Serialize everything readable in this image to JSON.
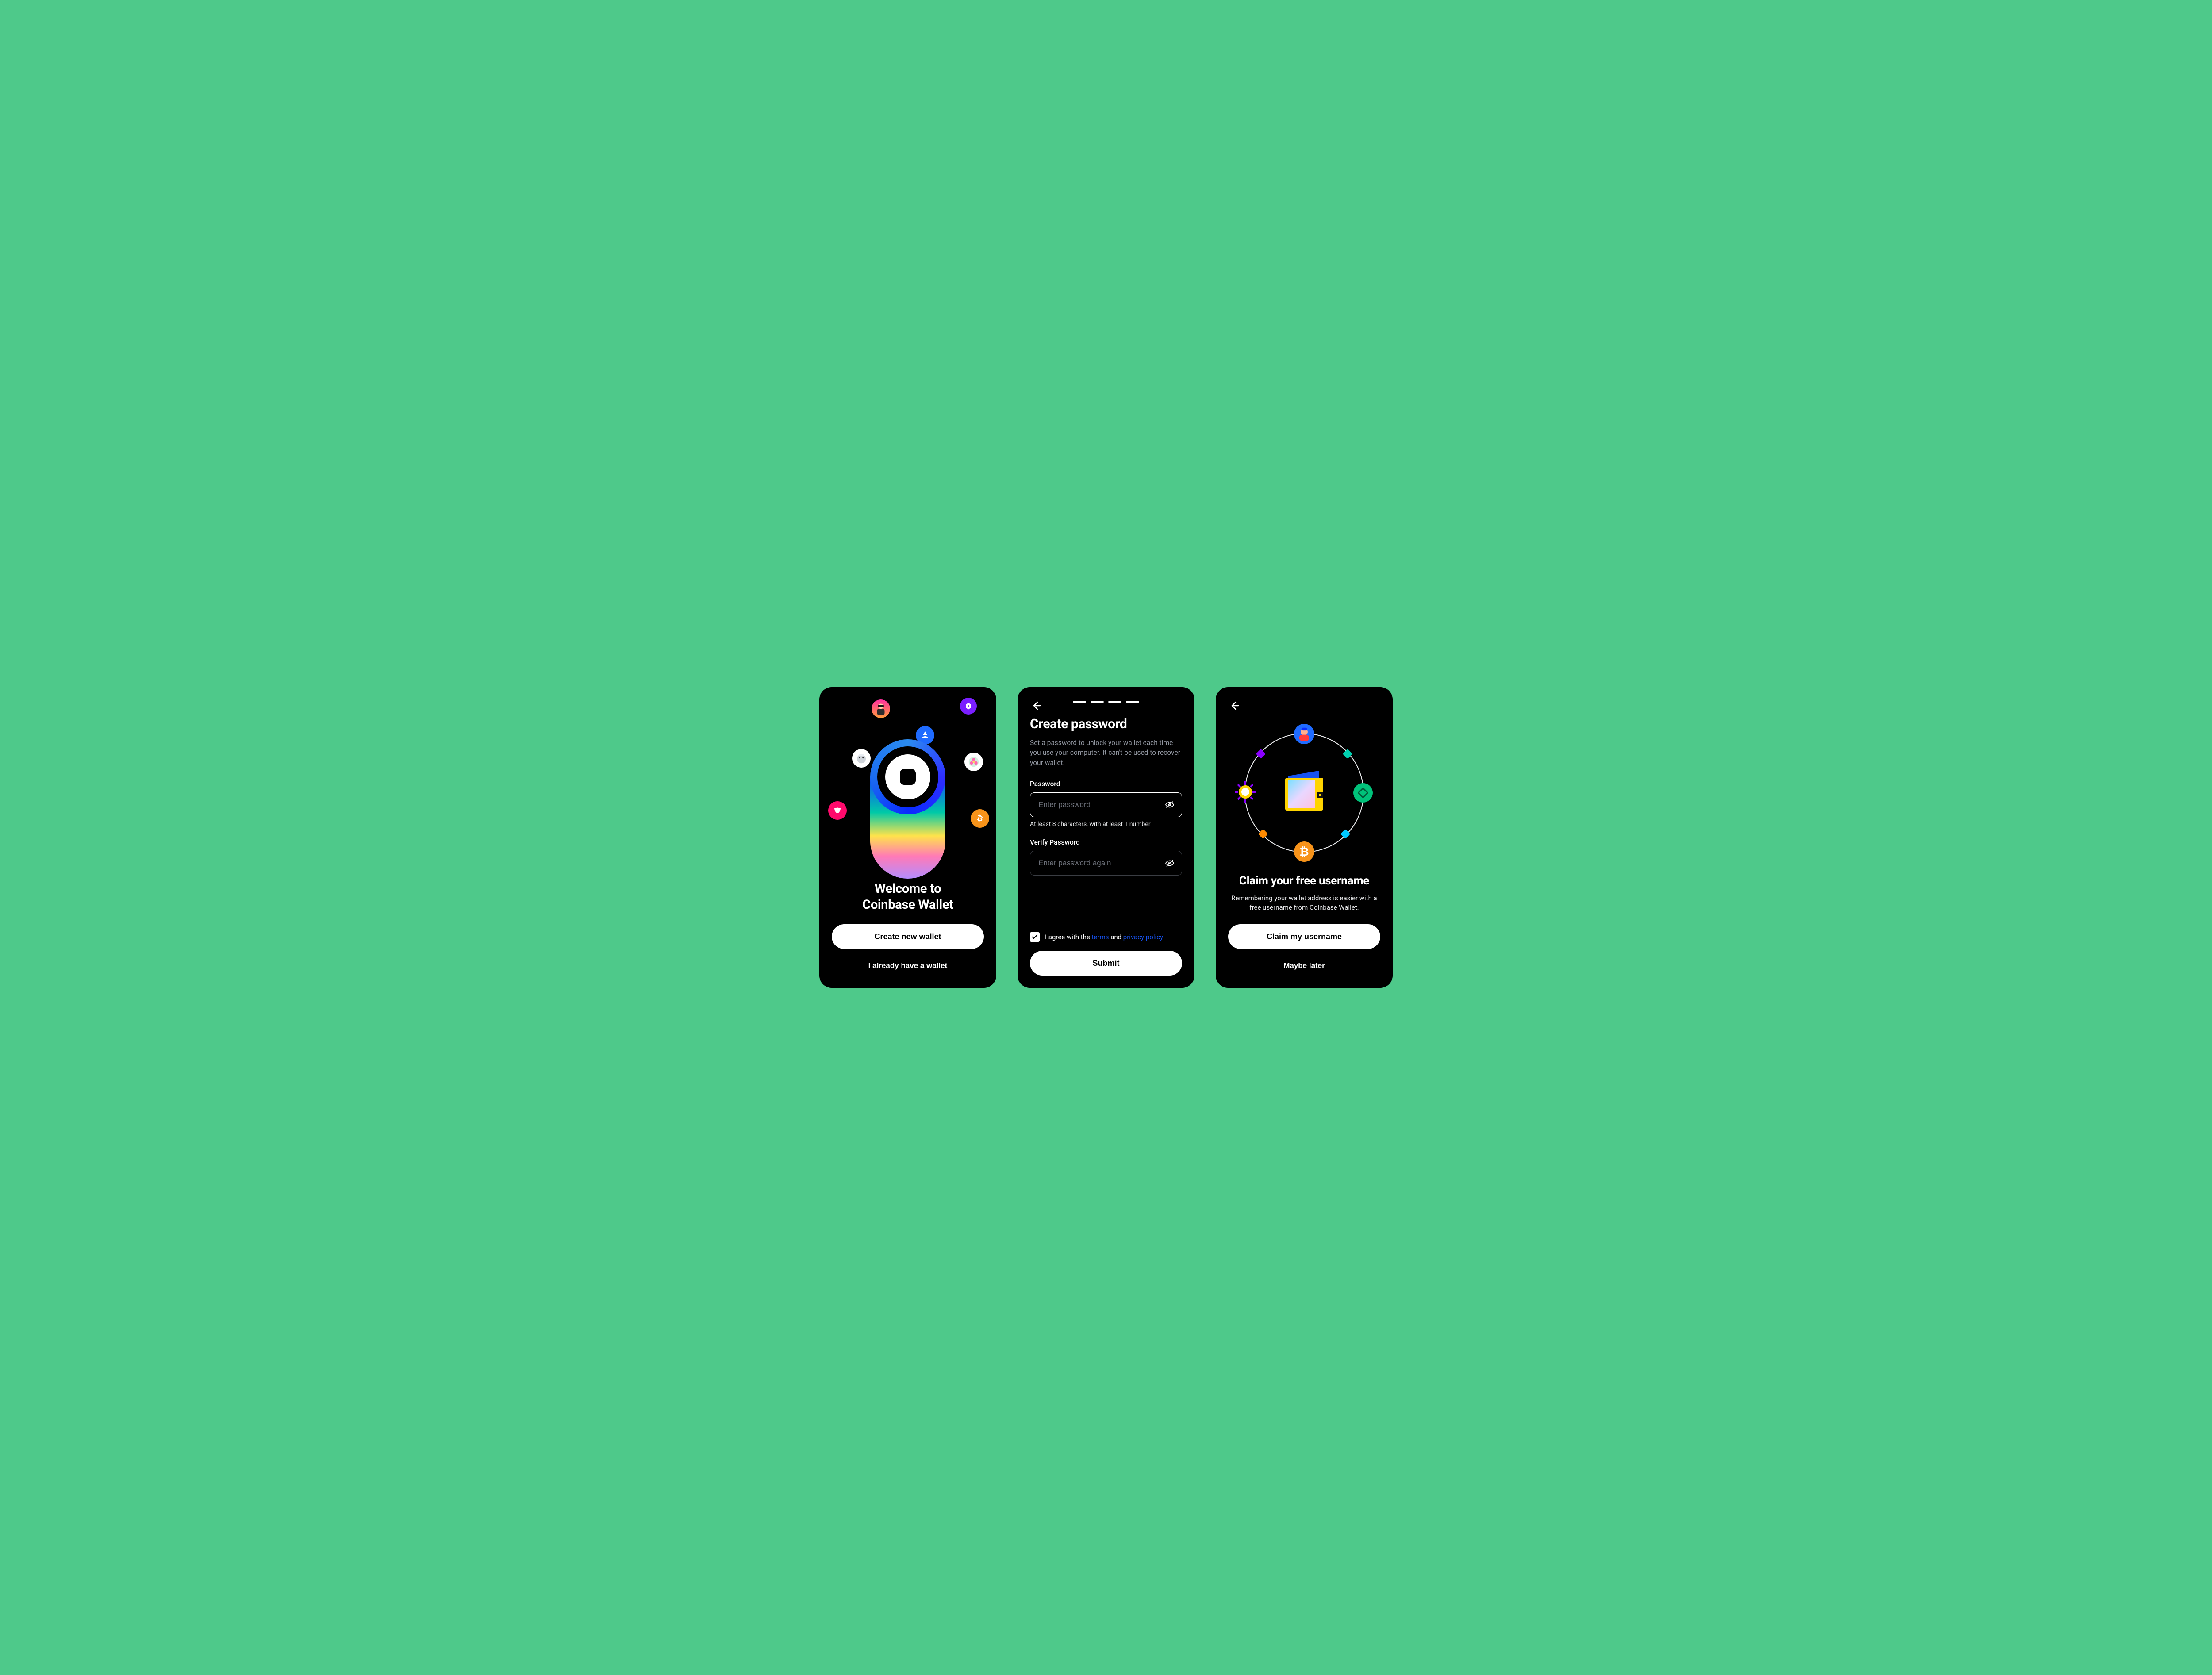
{
  "screen1": {
    "title_line1": "Welcome to",
    "title_line2": "Coinbase Wallet",
    "primary": "Create new wallet",
    "secondary": "I already have a wallet"
  },
  "screen2": {
    "title": "Create password",
    "subtitle": "Set a password to unlock your wallet each time you use your computer. It can't be used to recover your wallet.",
    "password_label": "Password",
    "password_placeholder": "Enter password",
    "password_hint": "At least 8 characters, with at least 1 number",
    "verify_label": "Verify Password",
    "verify_placeholder": "Enter password again",
    "agree_prefix": "I agree with the ",
    "terms": "terms",
    "agree_mid": " and ",
    "privacy": "privacy policy",
    "submit": "Submit",
    "progress_steps": 4
  },
  "screen3": {
    "title": "Claim your free username",
    "subtitle": "Remembering your wallet address is easier with a free username from Coinbase Wallet.",
    "primary": "Claim my username",
    "secondary": "Maybe later"
  }
}
